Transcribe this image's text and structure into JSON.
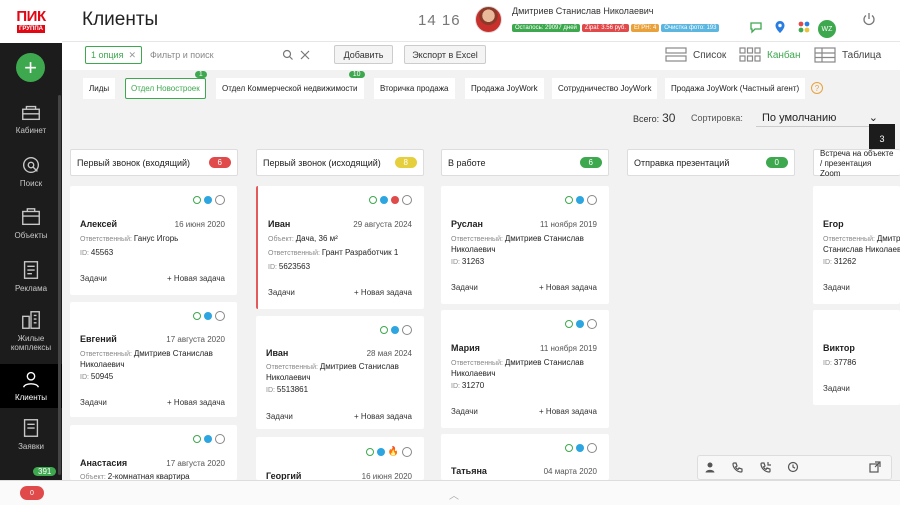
{
  "brand": {
    "logo_text": "ПИК",
    "logo_sub": "ГРУППА"
  },
  "sidebar": {
    "items": [
      {
        "label": "Кабинет",
        "icon": "cabinet-icon"
      },
      {
        "label": "Поиск",
        "icon": "search-icon"
      },
      {
        "label": "Объекты",
        "icon": "objects-icon"
      },
      {
        "label": "Реклама",
        "icon": "ads-icon"
      },
      {
        "label": "Жилые комплексы",
        "icon": "buildings-icon"
      },
      {
        "label": "Клиенты",
        "icon": "clients-icon"
      },
      {
        "label": "Заявки",
        "icon": "requests-icon"
      }
    ],
    "badge": "391"
  },
  "header": {
    "title": "Клиенты",
    "clock_h": "14",
    "clock_m": "16",
    "user_name": "Дмитриев Станислав Николаевич",
    "pills": [
      {
        "text": "Осталось: 29097 дней",
        "color": "#3ea84f"
      },
      {
        "text": "Zipal: 3.56 руб.",
        "color": "#e04a4a"
      },
      {
        "text": "ЕГРН: 4",
        "color": "#e9a23b"
      },
      {
        "text": "Очистка фото: 193",
        "color": "#5bb6e0"
      }
    ],
    "wz": "WZ"
  },
  "filter": {
    "chip_label": "1 опция",
    "search_placeholder": "Фильтр и поиск",
    "add_label": "Добавить",
    "export_label": "Экспорт в Excel",
    "views": [
      {
        "label": "Список"
      },
      {
        "label": "Канбан"
      },
      {
        "label": "Таблица"
      }
    ]
  },
  "tabs": [
    {
      "label": "Лиды",
      "badge": ""
    },
    {
      "label": "Отдел Новостроек",
      "badge": "1"
    },
    {
      "label": "Отдел Коммерческой недвижимости",
      "badge": "10"
    },
    {
      "label": "Вторичка продажа",
      "badge": ""
    },
    {
      "label": "Продажа JoyWork",
      "badge": ""
    },
    {
      "label": "Сотрудничество JoyWork",
      "badge": ""
    },
    {
      "label": "Продажа JoyWork (Частный агент)",
      "badge": ""
    }
  ],
  "summary": {
    "total_label": "Всего:",
    "total": "30",
    "sort_label": "Сортировка:",
    "sort_value": "По умолчанию",
    "page": "3"
  },
  "columns": [
    {
      "title": "Первый звонок (входящий)",
      "count": "6",
      "color": "#e04a4a"
    },
    {
      "title": "Первый звонок (исходящий)",
      "count": "8",
      "color": "#e6cf3d"
    },
    {
      "title": "В работе",
      "count": "6",
      "color": "#3ea84f"
    },
    {
      "title": "Отправка презентаций",
      "count": "0",
      "color": "#3ea84f"
    },
    {
      "title": "Встреча на объекте / презентация Zoom",
      "count": "",
      "color": ""
    }
  ],
  "labels": {
    "resp": "Ответственный:",
    "id": "ID:",
    "object": "Объект:",
    "tasks": "Задачи",
    "new_task": "+ Новая задача"
  },
  "cards": {
    "c1": [
      {
        "name": "Алексей",
        "date": "16 июня 2020",
        "resp": "Ганус Игорь",
        "id": "45563"
      },
      {
        "name": "Евгений",
        "date": "17 августа 2020",
        "resp": "Дмитриев Станислав Николаевич",
        "id": "50945"
      },
      {
        "name": "Анастасия",
        "date": "17 августа 2020",
        "object": "2-комнатная квартира"
      }
    ],
    "c2": [
      {
        "name": "Иван",
        "date": "29 августа 2024",
        "object": "Дача, 36 м²",
        "resp": "Грант Разработчик 1",
        "id": "5623563"
      },
      {
        "name": "Иван",
        "date": "28 мая 2024",
        "resp": "Дмитриев Станислав Николаевич",
        "id": "5513861"
      },
      {
        "name": "Георгий",
        "date": "16 июня 2020"
      }
    ],
    "c3": [
      {
        "name": "Руслан",
        "date": "11 ноября 2019",
        "resp": "Дмитриев Станислав Николаевич",
        "id": "31263"
      },
      {
        "name": "Мария",
        "date": "11 ноября 2019",
        "resp": "Дмитриев Станислав Николаевич",
        "id": "31270"
      },
      {
        "name": "Татьяна",
        "date": "04 марта 2020"
      }
    ],
    "c5": [
      {
        "name": "Егор",
        "resp": "Дмитриев Станислав Николаевич",
        "id": "31262"
      },
      {
        "name": "Виктор",
        "id": "37786"
      }
    ]
  },
  "bottom": {
    "red_count": "0"
  }
}
